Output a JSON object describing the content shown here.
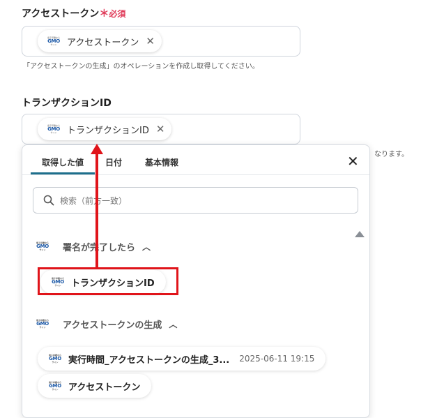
{
  "access_token_field": {
    "label": "アクセストークン",
    "required_mark": "＊",
    "required_text": "必須",
    "chip_label": "アクセストークン",
    "help": "「アクセストークンの生成」のオペレーションを作成し取得してください。"
  },
  "transaction_field": {
    "label": "トランザクションID",
    "chip_label": "トランザクションID",
    "help_tail": "なります。"
  },
  "logo": {
    "top": "電子印鑑なら",
    "mid": "GMO",
    "bottom": "サイン"
  },
  "panel": {
    "tabs": [
      "取得した値",
      "日付",
      "基本情報"
    ],
    "active_tab": "取得した値",
    "close_icon": "close-icon",
    "search_placeholder": "検索（前方一致）",
    "groups": [
      {
        "title": "署名が完了したら",
        "items": [
          {
            "label": "トランザクションID",
            "value": ""
          }
        ]
      },
      {
        "title": "アクセストークンの生成",
        "items": [
          {
            "label": "実行時間_アクセストークンの生成_3...",
            "value": "2025-06-11 19:15"
          },
          {
            "label": "アクセストークン",
            "value": ""
          }
        ]
      }
    ]
  },
  "colors": {
    "accent": "#1e6f8c",
    "required": "#e03c5a",
    "annotation": "#e0141a"
  }
}
